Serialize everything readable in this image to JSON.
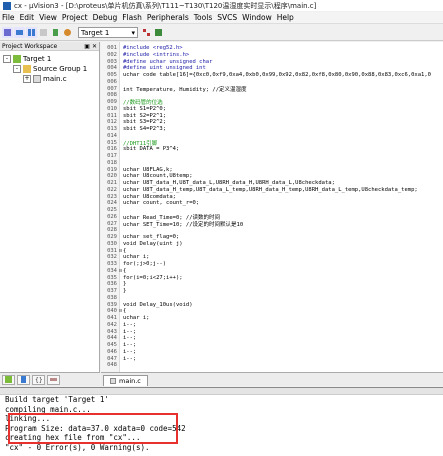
{
  "window": {
    "title": "cx - μVision3 - [D:\\proteus\\单片机仿真\\系列\\T111~T130\\T120温湿度实时显示\\程序\\main.c]"
  },
  "menu": [
    "File",
    "Edit",
    "View",
    "Project",
    "Debug",
    "Flash",
    "Peripherals",
    "Tools",
    "SVCS",
    "Window",
    "Help"
  ],
  "toolbar": {
    "target_select": "Target 1"
  },
  "workspace": {
    "title": "Project Workspace",
    "tree": [
      {
        "label": "Target 1",
        "level": 0,
        "kind": "target",
        "expander": "-"
      },
      {
        "label": "Source Group 1",
        "level": 1,
        "kind": "folder",
        "expander": "-"
      },
      {
        "label": "main.c",
        "level": 2,
        "kind": "file",
        "expander": "+"
      }
    ]
  },
  "editor": {
    "tab": "main.c",
    "lines": [
      {
        "n": "001",
        "fold": "",
        "text": "#include <reg52.h>",
        "kind": "pp"
      },
      {
        "n": "002",
        "fold": "",
        "text": "#include <intrins.h>",
        "kind": "pp"
      },
      {
        "n": "003",
        "fold": "",
        "text": "#define uchar unsigned char",
        "kind": "pp"
      },
      {
        "n": "004",
        "fold": "",
        "text": "#define uint unsigned int",
        "kind": "pp"
      },
      {
        "n": "005",
        "fold": "",
        "text": "uchar code table[16]={0xc0,0xf9,0xa4,0xb0,0x99,0x92,0x82,0xf8,0x80,0x90,0x88,0x83,0xc6,0xa1,0",
        "kind": "code"
      },
      {
        "n": "006",
        "fold": "",
        "text": "",
        "kind": "code"
      },
      {
        "n": "007",
        "fold": "",
        "text": "int Temperature, Humidity;  //定义温湿度",
        "kind": "code"
      },
      {
        "n": "008",
        "fold": "",
        "text": "",
        "kind": "code"
      },
      {
        "n": "009",
        "fold": "",
        "text": "//数码管的位选",
        "kind": "cm"
      },
      {
        "n": "010",
        "fold": "",
        "text": "sbit S1=P2^0;",
        "kind": "code"
      },
      {
        "n": "011",
        "fold": "",
        "text": "sbit S2=P2^1;",
        "kind": "code"
      },
      {
        "n": "012",
        "fold": "",
        "text": "sbit S3=P2^2;",
        "kind": "code"
      },
      {
        "n": "013",
        "fold": "",
        "text": "sbit S4=P2^3;",
        "kind": "code"
      },
      {
        "n": "014",
        "fold": "",
        "text": "",
        "kind": "code"
      },
      {
        "n": "015",
        "fold": "",
        "text": "//DHT11引脚",
        "kind": "cm"
      },
      {
        "n": "016",
        "fold": "",
        "text": "sbit DATA = P3^4;",
        "kind": "code"
      },
      {
        "n": "017",
        "fold": "",
        "text": "",
        "kind": "code"
      },
      {
        "n": "018",
        "fold": "",
        "text": "",
        "kind": "code"
      },
      {
        "n": "019",
        "fold": "",
        "text": "uchar   U8FLAG,k;",
        "kind": "code"
      },
      {
        "n": "020",
        "fold": "",
        "text": "uchar   U8count,U8temp;",
        "kind": "code"
      },
      {
        "n": "021",
        "fold": "",
        "text": "uchar   U8T_data_H,U8T_data_L,U8RH_data_H,U8RH_data_L,U8checkdata;",
        "kind": "code"
      },
      {
        "n": "022",
        "fold": "",
        "text": "uchar   U8T_data_H_temp,U8T_data_L_temp,U8RH_data_H_temp,U8RH_data_L_temp,U8checkdata_temp;",
        "kind": "code"
      },
      {
        "n": "023",
        "fold": "",
        "text": "uchar   U8comdata;",
        "kind": "code"
      },
      {
        "n": "024",
        "fold": "",
        "text": "uchar   count, count_r=0;",
        "kind": "code"
      },
      {
        "n": "025",
        "fold": "",
        "text": "",
        "kind": "code"
      },
      {
        "n": "026",
        "fold": "",
        "text": "uchar Read_Time=0;   //读数的时间",
        "kind": "code"
      },
      {
        "n": "027",
        "fold": "",
        "text": "uchar SET_Time=10;   //设定的时间默认是10",
        "kind": "code"
      },
      {
        "n": "028",
        "fold": "",
        "text": "",
        "kind": "code"
      },
      {
        "n": "029",
        "fold": "",
        "text": "uchar set_flag=0;",
        "kind": "code"
      },
      {
        "n": "030",
        "fold": "",
        "text": "void Delay(uint j)",
        "kind": "code"
      },
      {
        "n": "031",
        "fold": "⊟",
        "text": "{",
        "kind": "code"
      },
      {
        "n": "032",
        "fold": "",
        "text": "  uchar i;",
        "kind": "code"
      },
      {
        "n": "033",
        "fold": "",
        "text": "  for(;j>0;j--)",
        "kind": "code"
      },
      {
        "n": "034",
        "fold": "⊟",
        "text": "  {",
        "kind": "code"
      },
      {
        "n": "035",
        "fold": "",
        "text": "    for(i=0;i<27;i++);",
        "kind": "code"
      },
      {
        "n": "036",
        "fold": "",
        "text": "  }",
        "kind": "code"
      },
      {
        "n": "037",
        "fold": "",
        "text": "}",
        "kind": "code"
      },
      {
        "n": "038",
        "fold": "",
        "text": "",
        "kind": "code"
      },
      {
        "n": "039",
        "fold": "",
        "text": "void  Delay_10us(void)",
        "kind": "code"
      },
      {
        "n": "040",
        "fold": "⊟",
        "text": "{",
        "kind": "code"
      },
      {
        "n": "041",
        "fold": "",
        "text": "  uchar i;",
        "kind": "code"
      },
      {
        "n": "042",
        "fold": "",
        "text": "  i--;",
        "kind": "code"
      },
      {
        "n": "043",
        "fold": "",
        "text": "  i--;",
        "kind": "code"
      },
      {
        "n": "044",
        "fold": "",
        "text": "  i--;",
        "kind": "code"
      },
      {
        "n": "045",
        "fold": "",
        "text": "  i--;",
        "kind": "code"
      },
      {
        "n": "046",
        "fold": "",
        "text": "  i--;",
        "kind": "code"
      },
      {
        "n": "047",
        "fold": "",
        "text": "  i--;",
        "kind": "code"
      },
      {
        "n": "048",
        "fold": "",
        "text": "",
        "kind": "code"
      }
    ]
  },
  "output": {
    "lines": [
      "Build target 'Target 1'",
      "compiling main.c...",
      "linking...",
      "Program Size: data=37.0 xdata=0 code=542",
      "creating hex file from \"cx\"...",
      "\"cx\" - 0 Error(s), 0 Warning(s)."
    ]
  },
  "colors": {
    "keyword": "#1a1aa6",
    "comment": "#1b9a1b",
    "highlight": "#e8312f"
  }
}
